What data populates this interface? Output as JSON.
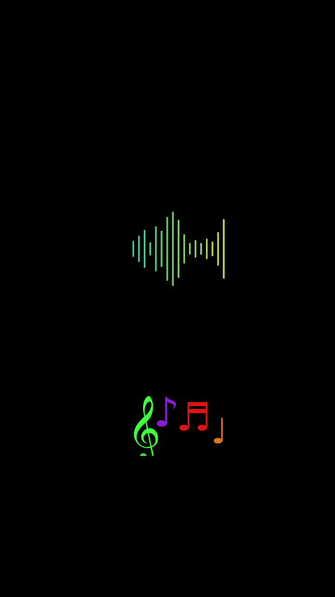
{
  "screen": {
    "background": "#000000"
  },
  "waveform": {
    "icon": "audio-waveform-icon",
    "bar_levels": [
      0.2,
      0.34,
      0.5,
      0.16,
      0.6,
      0.48,
      0.86,
      1.0,
      0.78,
      0.38,
      0.14,
      0.22,
      0.14,
      0.26,
      0.18,
      0.44,
      0.8
    ],
    "gradient_colors": [
      "#3cc8a8",
      "#62d07a",
      "#9ed84e",
      "#e8e63a"
    ]
  },
  "notes": {
    "icon": "music-notes-icon",
    "items": [
      {
        "name": "treble-clef-icon",
        "glyph": "𝄞",
        "color": "#3dff3d"
      },
      {
        "name": "eighth-note-icon",
        "glyph": "♪",
        "color": "#8a1bd6"
      },
      {
        "name": "beamed-sixteenth-notes-icon",
        "glyph": "♬",
        "color": "#e31212"
      },
      {
        "name": "quarter-note-icon",
        "glyph": "♩",
        "color": "#e0781a"
      }
    ]
  }
}
